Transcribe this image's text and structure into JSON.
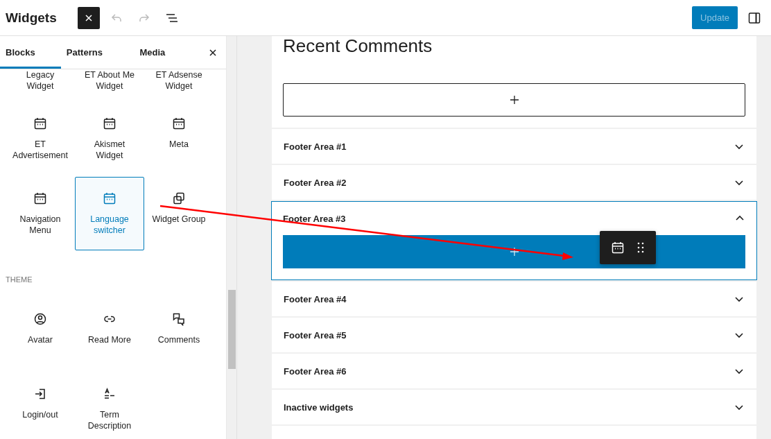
{
  "header": {
    "title": "Widgets",
    "undo": {
      "disabled": true
    },
    "redo": {
      "disabled": true
    },
    "update": {
      "label": "Update",
      "disabled": true
    }
  },
  "tabs": [
    {
      "label": "Blocks",
      "selected": true
    },
    {
      "label": "Patterns",
      "selected": false
    },
    {
      "label": "Media",
      "selected": false
    }
  ],
  "sections": [
    {
      "blocks": [
        {
          "label": "Legacy Widget",
          "kind": "clipped",
          "selected": false
        },
        {
          "label": "ET About Me Widget",
          "kind": "clipped",
          "selected": false
        },
        {
          "label": "ET Adsense Widget",
          "kind": "clipped",
          "selected": false
        },
        {
          "label": "ET Advertisement",
          "kind": "calendar",
          "selected": false
        },
        {
          "label": "Akismet Widget",
          "kind": "calendar",
          "selected": false
        },
        {
          "label": "Meta",
          "kind": "calendar",
          "selected": false
        },
        {
          "label": "Navigation Menu",
          "kind": "calendar",
          "selected": false
        },
        {
          "label": "Language switcher",
          "kind": "calendar",
          "selected": true
        },
        {
          "label": "Widget Group",
          "kind": "group",
          "selected": false
        }
      ]
    },
    {
      "heading": "THEME",
      "blocks": [
        {
          "label": "Avatar",
          "kind": "avatar",
          "selected": false
        },
        {
          "label": "Read More",
          "kind": "link",
          "selected": false
        },
        {
          "label": "Comments",
          "kind": "comments",
          "selected": false
        },
        {
          "label": "Login/out",
          "kind": "login",
          "selected": false
        },
        {
          "label": "Term Description",
          "kind": "term",
          "selected": false
        }
      ]
    }
  ],
  "top_panel": {
    "heading": "Recent Comments"
  },
  "areas": [
    {
      "name": "Footer Area #1",
      "expanded": false
    },
    {
      "name": "Footer Area #2",
      "expanded": false
    },
    {
      "name": "Footer Area #3",
      "expanded": true
    },
    {
      "name": "Footer Area #4",
      "expanded": false
    },
    {
      "name": "Footer Area #5",
      "expanded": false
    },
    {
      "name": "Footer Area #6",
      "expanded": false
    },
    {
      "name": "Inactive widgets",
      "expanded": false
    }
  ]
}
